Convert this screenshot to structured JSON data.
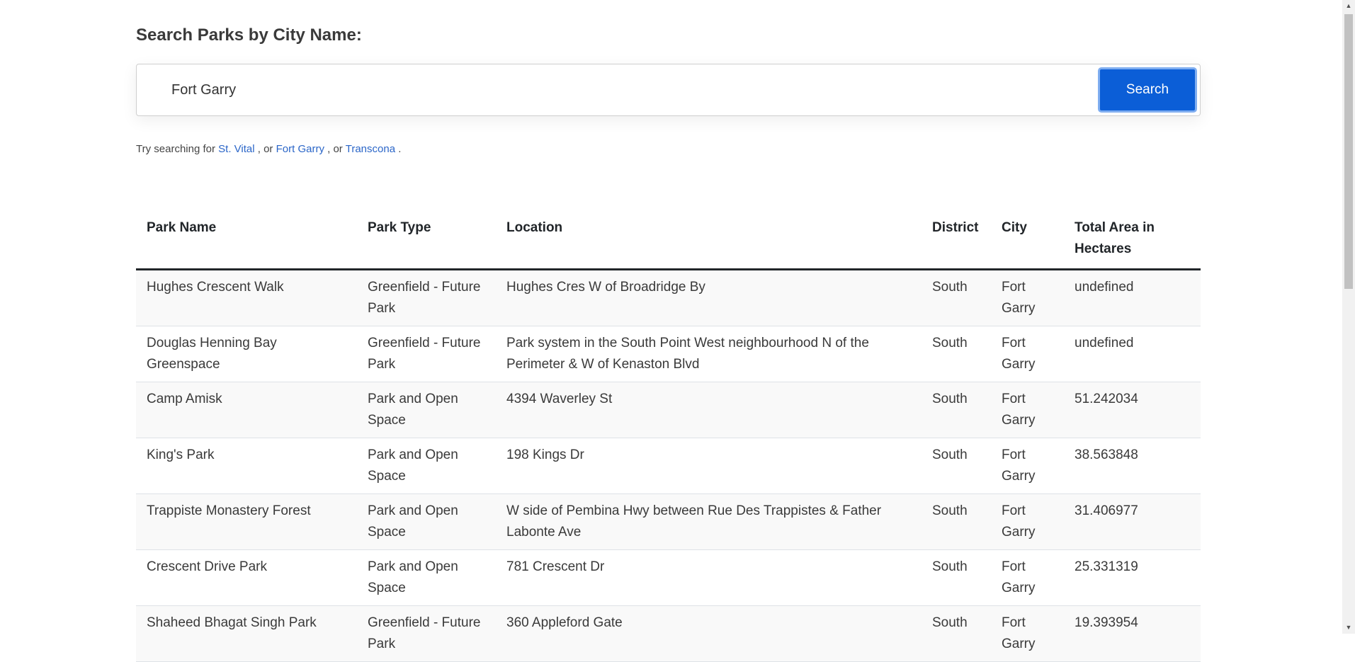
{
  "search": {
    "heading": "Search Parks by City Name:",
    "input_value": "Fort Garry",
    "button_label": "Search"
  },
  "hint": {
    "prefix": "Try searching for",
    "suggestions": [
      "St. Vital",
      "Fort Garry",
      "Transcona"
    ],
    "sep1": ", or",
    "sep2": ", or",
    "suffix": "."
  },
  "table": {
    "headers": [
      "Park Name",
      "Park Type",
      "Location",
      "District",
      "City",
      "Total Area in Hectares"
    ],
    "rows": [
      [
        "Hughes Crescent Walk",
        "Greenfield - Future Park",
        "Hughes Cres W of Broadridge By",
        "South",
        "Fort Garry",
        "undefined"
      ],
      [
        "Douglas Henning Bay Greenspace",
        "Greenfield - Future Park",
        "Park system in the South Point West neighbourhood N of the Perimeter & W of Kenaston Blvd",
        "South",
        "Fort Garry",
        "undefined"
      ],
      [
        "Camp Amisk",
        "Park and Open Space",
        "4394 Waverley St",
        "South",
        "Fort Garry",
        "51.242034"
      ],
      [
        "King's Park",
        "Park and Open Space",
        "198 Kings Dr",
        "South",
        "Fort Garry",
        "38.563848"
      ],
      [
        "Trappiste Monastery Forest",
        "Park and Open Space",
        "W side of Pembina Hwy between Rue Des Trappistes & Father Labonte Ave",
        "South",
        "Fort Garry",
        "31.406977"
      ],
      [
        "Crescent Drive Park",
        "Park and Open Space",
        "781 Crescent Dr",
        "South",
        "Fort Garry",
        "25.331319"
      ],
      [
        "Shaheed Bhagat Singh Park",
        "Greenfield - Future Park",
        "360 Appleford Gate",
        "South",
        "Fort Garry",
        "19.393954"
      ]
    ]
  },
  "colors": {
    "accent": "#0b5ed7",
    "link": "#2b66c8"
  }
}
